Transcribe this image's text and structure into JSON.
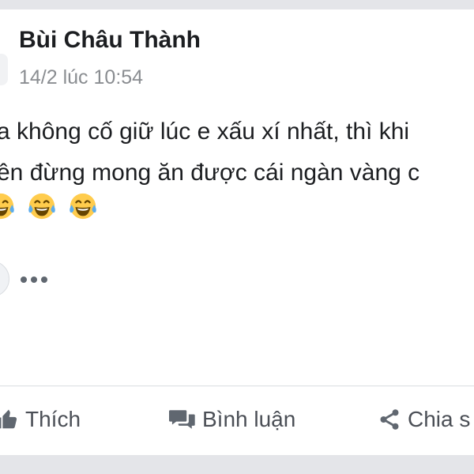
{
  "post": {
    "author": "Bùi Châu Thành",
    "timestamp": "14/2 lúc 10:54",
    "lines": [
      "a không cố giữ lúc e xấu xí nhất, thì khi",
      "ên đừng mong ăn được cái ngàn vàng c"
    ],
    "emojis": [
      "face-with-tears-of-joy",
      "face-with-tears-of-joy",
      "face-with-tears-of-joy"
    ]
  },
  "actions": {
    "like": "Thích",
    "comment": "Bình luận",
    "share": "Chia s"
  },
  "icons": {
    "more": "more-dots-icon",
    "like": "thumbs-up-icon",
    "comment": "comment-bubbles-icon",
    "share": "share-nodes-icon"
  },
  "colors": {
    "background": "#e4e5e9",
    "card": "#ffffff",
    "text": "#1c1e21",
    "muted": "#8a8d91",
    "action": "#4b4f56",
    "emoji_face": "#ffcc4d"
  }
}
